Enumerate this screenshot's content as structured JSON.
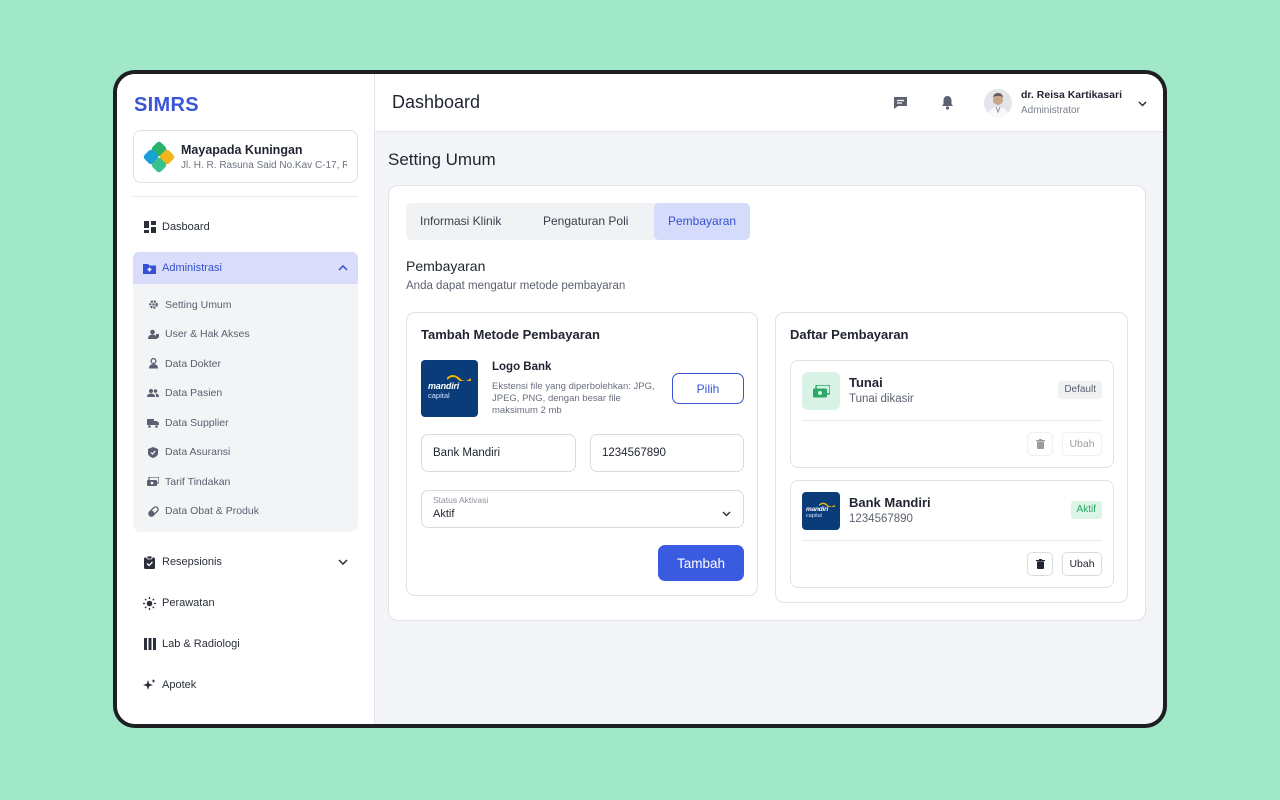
{
  "brand": "SIMRS",
  "clinic": {
    "name": "Mayapada Kuningan",
    "address": "Jl. H. R. Rasuna Said No.Kav C-17, R..."
  },
  "sidebar": {
    "items": [
      {
        "label": "Dasboard",
        "icon": "dashboard-icon"
      },
      {
        "label": "Administrasi",
        "icon": "folder-plus-icon",
        "expanded": true
      },
      {
        "label": "Resepsionis",
        "icon": "clipboard-check-icon"
      },
      {
        "label": "Perawatan",
        "icon": "sun-icon"
      },
      {
        "label": "Lab & Radiologi",
        "icon": "bars-icon"
      },
      {
        "label": "Apotek",
        "icon": "sparkle-icon"
      }
    ],
    "subitems": [
      {
        "label": "Setting Umum",
        "icon": "gear-icon"
      },
      {
        "label": "User & Hak Akses",
        "icon": "user-shield-icon"
      },
      {
        "label": "Data Dokter",
        "icon": "doctor-icon"
      },
      {
        "label": "Data Pasien",
        "icon": "users-icon"
      },
      {
        "label": "Data Supplier",
        "icon": "truck-icon"
      },
      {
        "label": "Data Asuransi",
        "icon": "shield-icon"
      },
      {
        "label": "Tarif Tindakan",
        "icon": "money-icon"
      },
      {
        "label": "Data Obat & Produk",
        "icon": "pill-icon"
      }
    ]
  },
  "header": {
    "title": "Dashboard",
    "user": {
      "name": "dr. Reisa Kartikasari",
      "role": "Administrator"
    }
  },
  "page": {
    "title": "Setting Umum"
  },
  "tabs": [
    {
      "label": "Informasi Klinik"
    },
    {
      "label": "Pengaturan Poli"
    },
    {
      "label": "Pembayaran",
      "active": true
    }
  ],
  "section": {
    "title": "Pembayaran",
    "subtitle": "Anda dapat mengatur metode pembayaran"
  },
  "form": {
    "title": "Tambah Metode Pembayaran",
    "logo_label": "Logo Bank",
    "logo_help": "Ekstensi file yang diperbolehkan: JPG, JPEG, PNG, dengan besar file maksimum 2 mb",
    "choose_label": "Pilih",
    "bank_name": "Bank Mandiri",
    "account_number": "1234567890",
    "status_label": "Status Aktivasi",
    "status_value": "Aktif",
    "submit_label": "Tambah"
  },
  "bank_logo": {
    "text1": "mandiri",
    "text2": "capital"
  },
  "list": {
    "title": "Daftar Pembayaran",
    "items": [
      {
        "name": "Tunai",
        "desc": "Tunai dikasir",
        "badge": "Default",
        "edit_label": "Ubah"
      },
      {
        "name": "Bank Mandiri",
        "desc": "1234567890",
        "badge": "Aktif",
        "edit_label": "Ubah"
      }
    ]
  },
  "colors": {
    "accent": "#3a56d6",
    "background": "#a0e8c8",
    "active_tab": "#d5dbfb",
    "success": "#2aa866"
  }
}
